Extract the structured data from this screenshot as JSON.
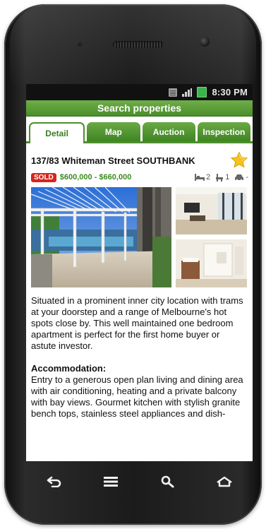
{
  "status_bar": {
    "time": "8:30 PM",
    "icons": [
      "sim-icon",
      "signal-icon",
      "battery-icon"
    ]
  },
  "app_title": "Search properties",
  "tabs": [
    {
      "label": "Detail",
      "active": true
    },
    {
      "label": "Map",
      "active": false
    },
    {
      "label": "Auction",
      "active": false
    },
    {
      "label": "Inspection",
      "active": false
    }
  ],
  "listing": {
    "address": "137/83 Whiteman Street SOUTHBANK",
    "favorite_icon": "star-icon",
    "status_badge": "SOLD",
    "price": "$600,000 - $660,000",
    "bedrooms": "2",
    "bathrooms": "1",
    "parking": "-",
    "description": "Situated in a prominent inner city location with trams at your doorstep and a range of Melbourne's hot spots close by. This well maintained one bedroom apartment is perfect for the first home buyer or astute investor.",
    "accommodation_heading": "Accommodation:",
    "accommodation_text": "Entry to a generous open plan living and dining area with air conditioning, heating and a private balcony with bay views. Gourmet kitchen with stylish granite bench tops, stainless steel appliances and dish-"
  },
  "nav_buttons": [
    "back-icon",
    "menu-icon",
    "search-icon",
    "home-icon"
  ],
  "colors": {
    "brand_green": "#4b8e2a",
    "price_green": "#3f8a1f",
    "sold_red": "#d7251a",
    "star_gold": "#f7c21c"
  }
}
